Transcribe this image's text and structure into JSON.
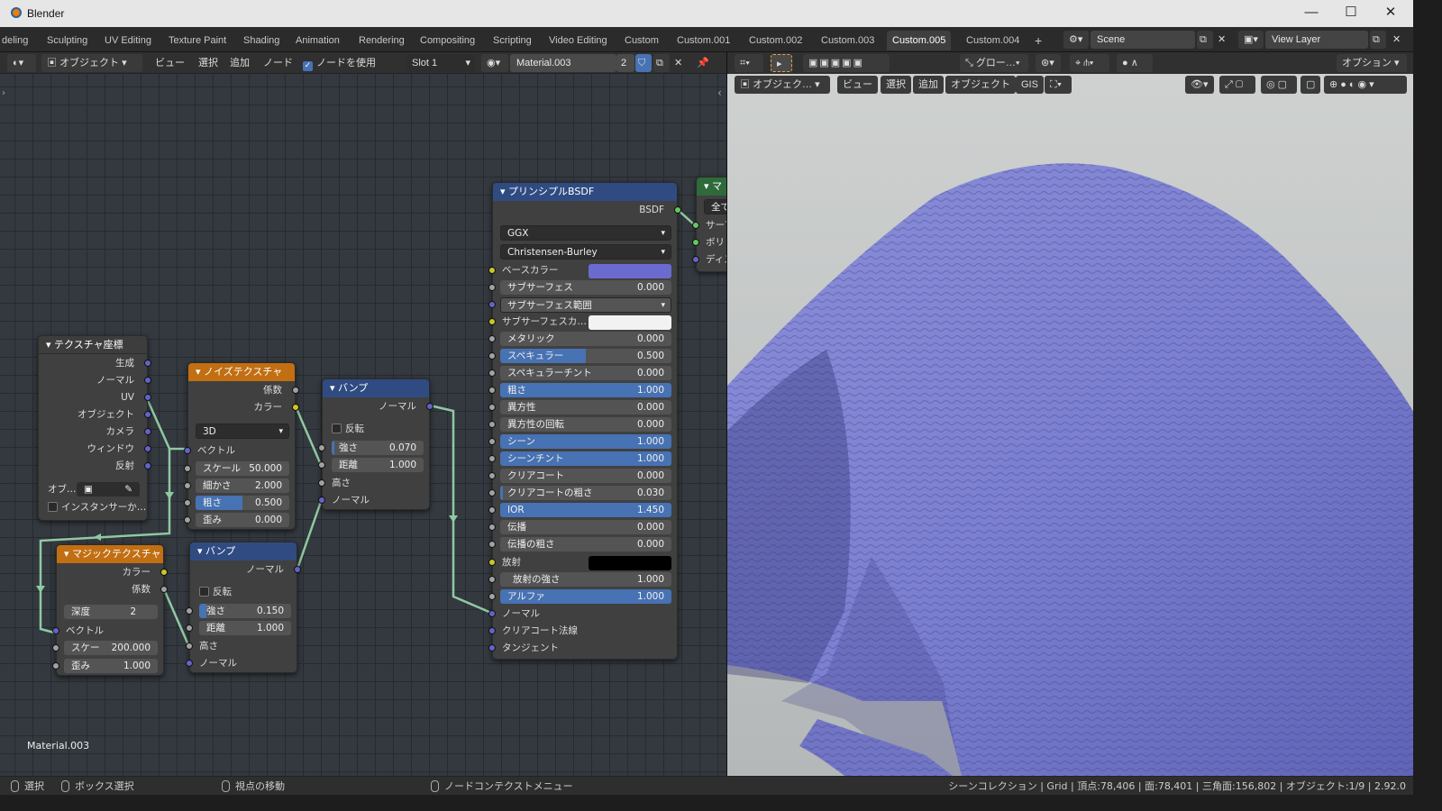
{
  "window": {
    "title": "Blender",
    "controls": [
      "—",
      "☐",
      "✕"
    ]
  },
  "workspace_tabs": [
    "deling",
    "Sculpting",
    "UV Editing",
    "Texture Paint",
    "Shading",
    "Animation",
    "Rendering",
    "Compositing",
    "Scripting",
    "Video Editing",
    "Custom",
    "Custom.001",
    "Custom.002",
    "Custom.003",
    "Custom.005",
    "Custom.004",
    "+"
  ],
  "active_tab": "Custom.005",
  "scene": {
    "name": "Scene",
    "view_layer": "View Layer"
  },
  "node_header": {
    "mode": "オブジェクト",
    "menus": [
      "ビュー",
      "選択",
      "追加",
      "ノード"
    ],
    "use_nodes_label": "ノードを使用",
    "slot": "Slot 1",
    "material": "Material.003",
    "users": "2"
  },
  "nodes": {
    "texcoord": {
      "title": "テクスチャ座標",
      "outputs": [
        "生成",
        "ノーマル",
        "UV",
        "オブジェクト",
        "カメラ",
        "ウィンドウ",
        "反射"
      ],
      "object_label": "オブ…",
      "instancer_label": "インスタンサーか…"
    },
    "noise": {
      "title": "ノイズテクスチャ",
      "outputs": [
        "係数",
        "カラー"
      ],
      "dimension": "3D",
      "vector_label": "ベクトル",
      "params": [
        {
          "label": "スケール",
          "value": "50.000"
        },
        {
          "label": "細かさ",
          "value": "2.000"
        },
        {
          "label": "粗さ",
          "value": "0.500",
          "fill": 0.5
        },
        {
          "label": "歪み",
          "value": "0.000"
        }
      ]
    },
    "bump1": {
      "title": "バンプ",
      "output": "ノーマル",
      "invert_label": "反転",
      "strength_label": "強さ",
      "strength": "0.070",
      "distance_label": "距離",
      "distance": "1.000",
      "height_label": "高さ",
      "normal_label": "ノーマル"
    },
    "magic": {
      "title": "マジックテクスチャ",
      "outputs": [
        "カラー",
        "係数"
      ],
      "depth_label": "深度",
      "depth": "2",
      "vector_label": "ベクトル",
      "scale_label": "スケー",
      "scale": "200.000",
      "distortion_label": "歪み",
      "distortion": "1.000"
    },
    "bump2": {
      "title": "バンプ",
      "output": "ノーマル",
      "invert_label": "反転",
      "strength_label": "強さ",
      "strength": "0.150",
      "distance_label": "距離",
      "distance": "1.000",
      "height_label": "高さ",
      "normal_label": "ノーマル"
    },
    "bsdf": {
      "title": "プリンシプルBSDF",
      "output": "BSDF",
      "distribution": "GGX",
      "subsurface_method": "Christensen-Burley",
      "base_color_label": "ベースカラー",
      "base_color": "#6b6bcf",
      "subsurface_label": "サブサーフェス",
      "subsurface": "0.000",
      "subsurface_radius_label": "サブサーフェス範囲",
      "subsurface_color_label": "サブサーフェスカ…",
      "subsurface_color": "#f2f2f2",
      "params": [
        {
          "label": "メタリック",
          "value": "0.000",
          "fill": 0
        },
        {
          "label": "スペキュラー",
          "value": "0.500",
          "fill": 0.5
        },
        {
          "label": "スペキュラーチント",
          "value": "0.000",
          "fill": 0
        },
        {
          "label": "粗さ",
          "value": "1.000",
          "fill": 1
        },
        {
          "label": "異方性",
          "value": "0.000",
          "fill": 0
        },
        {
          "label": "異方性の回転",
          "value": "0.000",
          "fill": 0
        },
        {
          "label": "シーン",
          "value": "1.000",
          "fill": 1
        },
        {
          "label": "シーンチント",
          "value": "1.000",
          "fill": 1
        },
        {
          "label": "クリアコート",
          "value": "0.000",
          "fill": 0
        },
        {
          "label": "クリアコートの粗さ",
          "value": "0.030",
          "fill": 0.03
        },
        {
          "label": "IOR",
          "value": "1.450",
          "fill": 1
        },
        {
          "label": "伝播",
          "value": "0.000",
          "fill": 0
        },
        {
          "label": "伝播の粗さ",
          "value": "0.000",
          "fill": 0
        }
      ],
      "emission_label": "放射",
      "emission_color": "#000000",
      "emission_strength_label": "放射の強さ",
      "emission_strength": "1.000",
      "alpha_label": "アルファ",
      "alpha": "1.000",
      "inputs_tail": [
        "ノーマル",
        "クリアコート法線",
        "タンジェント"
      ]
    },
    "output": {
      "title": "マ",
      "target": "全て",
      "inputs": [
        "サーフ",
        "ボリ",
        "ディス"
      ]
    }
  },
  "material_label": "Material.003",
  "viewport_header": {
    "transform": "グロー…",
    "options": "オプション",
    "mode": "オブジェク…",
    "menus": [
      "ビュー",
      "選択",
      "追加",
      "オブジェクト",
      "GIS"
    ]
  },
  "status": {
    "select": "選択",
    "box_select": "ボックス選択",
    "rotate_view": "視点の移動",
    "context_menu": "ノードコンテクストメニュー",
    "stats": "シーンコレクション | Grid | 頂点:78,406 | 面:78,401 | 三角面:156,802 | オブジェクト:1/9 | 2.92.0"
  },
  "colors": {
    "accent": "#4772b3",
    "cloth": "#7b7fcf",
    "wire": "#8fc9a3"
  }
}
